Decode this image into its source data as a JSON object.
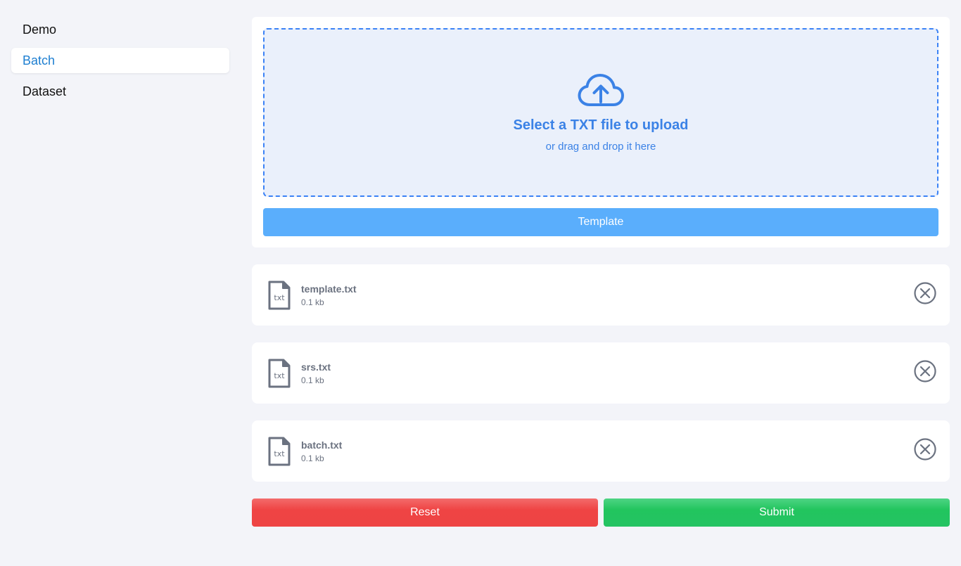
{
  "sidebar": {
    "items": [
      {
        "label": "Demo"
      },
      {
        "label": "Batch"
      },
      {
        "label": "Dataset"
      }
    ],
    "active": "Batch"
  },
  "upload": {
    "title": "Select a TXT file to upload",
    "subtitle": "or drag and drop it here",
    "icon": "cloud-upload-icon",
    "template_label": "Template"
  },
  "files": [
    {
      "name": "template.txt",
      "size": "0.1 kb",
      "icon_label": "txt"
    },
    {
      "name": "srs.txt",
      "size": "0.1 kb",
      "icon_label": "txt"
    },
    {
      "name": "batch.txt",
      "size": "0.1 kb",
      "icon_label": "txt"
    }
  ],
  "actions": {
    "reset_label": "Reset",
    "submit_label": "Submit"
  },
  "colors": {
    "accent": "#3b82e6",
    "template_button": "#5aaefc",
    "reset": "#ef4444",
    "submit": "#22c55e",
    "active_nav": "#1e7fd1"
  }
}
